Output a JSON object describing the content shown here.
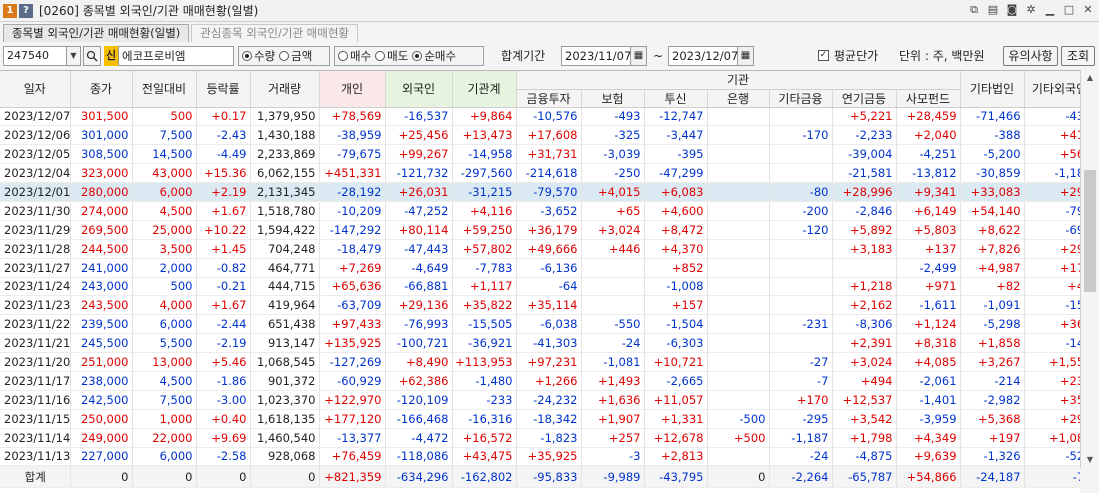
{
  "window": {
    "badge1": "1",
    "badge2": "?",
    "title": "[0260] 종목별 외국인/기관 매매현황(일별)"
  },
  "tabs": [
    {
      "label": "종목별 외국인/기관 매매현황(일별)"
    },
    {
      "label": "관심종목 외국인/기관 매매현황"
    }
  ],
  "toolbar": {
    "code": "247540",
    "badge": "신",
    "name": "에코프로비엠",
    "unit_radio": [
      {
        "label": "수량",
        "selected": true
      },
      {
        "label": "금액",
        "selected": false
      }
    ],
    "trade_radio": [
      {
        "label": "매수",
        "selected": false
      },
      {
        "label": "매도",
        "selected": false
      },
      {
        "label": "순매수",
        "selected": true
      }
    ],
    "period_label": "합계기간",
    "date_from": "2023/11/07",
    "tilde": "~",
    "date_to": "2023/12/07",
    "avg_label": "평균단가",
    "avg_checked": true,
    "unit_text": "단위 : 주, 백만원",
    "notice_button": "유의사항",
    "query_button": "조회"
  },
  "headers": {
    "date": "일자",
    "close": "종가",
    "change": "전일대비",
    "rate": "등락률",
    "volume": "거래량",
    "individual": "개인",
    "foreign": "외국인",
    "institution": "기관계",
    "inst_group": "기관",
    "financial": "금융투자",
    "insurance": "보험",
    "trust": "투신",
    "bank": "은행",
    "other_fin": "기타금융",
    "pension": "연기금등",
    "private_fund": "사모펀드",
    "other_corp": "기타법인",
    "other_foreign": "기타외국인"
  },
  "rows": [
    [
      "2023/12/07",
      "301,500",
      "500",
      "+0.17",
      "1,379,950",
      "+78,569",
      "-16,537",
      "+9,864",
      "-10,576",
      "-493",
      "-12,747",
      "",
      "",
      "+5,221",
      "+28,459",
      "-71,466",
      "-430"
    ],
    [
      "2023/12/06",
      "301,000",
      "7,500",
      "-2.43",
      "1,430,188",
      "-38,959",
      "+25,456",
      "+13,473",
      "+17,608",
      "-325",
      "-3,447",
      "",
      "-170",
      "-2,233",
      "+2,040",
      "-388",
      "+418"
    ],
    [
      "2023/12/05",
      "308,500",
      "14,500",
      "-4.49",
      "2,233,869",
      "-79,675",
      "+99,267",
      "-14,958",
      "+31,731",
      "-3,039",
      "-395",
      "",
      "",
      "-39,004",
      "-4,251",
      "-5,200",
      "+566"
    ],
    [
      "2023/12/04",
      "323,000",
      "43,000",
      "+15.36",
      "6,062,155",
      "+451,331",
      "-121,732",
      "-297,560",
      "-214,618",
      "-250",
      "-47,299",
      "",
      "",
      "-21,581",
      "-13,812",
      "-30,859",
      "-1,180"
    ],
    [
      "2023/12/01",
      "280,000",
      "6,000",
      "+2.19",
      "2,131,345",
      "-28,192",
      "+26,031",
      "-31,215",
      "-79,570",
      "+4,015",
      "+6,083",
      "",
      "-80",
      "+28,996",
      "+9,341",
      "+33,083",
      "+293"
    ],
    [
      "2023/11/30",
      "274,000",
      "4,500",
      "+1.67",
      "1,518,780",
      "-10,209",
      "-47,252",
      "+4,116",
      "-3,652",
      "+65",
      "+4,600",
      "",
      "-200",
      "-2,846",
      "+6,149",
      "+54,140",
      "-795"
    ],
    [
      "2023/11/29",
      "269,500",
      "25,000",
      "+10.22",
      "1,594,422",
      "-147,292",
      "+80,114",
      "+59,250",
      "+36,179",
      "+3,024",
      "+8,472",
      "",
      "-120",
      "+5,892",
      "+5,803",
      "+8,622",
      "-694"
    ],
    [
      "2023/11/28",
      "244,500",
      "3,500",
      "+1.45",
      "704,248",
      "-18,479",
      "-47,443",
      "+57,802",
      "+49,666",
      "+446",
      "+4,370",
      "",
      "",
      "+3,183",
      "+137",
      "+7,826",
      "+294"
    ],
    [
      "2023/11/27",
      "241,000",
      "2,000",
      "-0.82",
      "464,771",
      "+7,269",
      "-4,649",
      "-7,783",
      "-6,136",
      "",
      "+852",
      "",
      "",
      "",
      "-2,499",
      "+4,987",
      "+176"
    ],
    [
      "2023/11/24",
      "243,000",
      "500",
      "-0.21",
      "444,715",
      "+65,636",
      "-66,881",
      "+1,117",
      "-64",
      "",
      "-1,008",
      "",
      "",
      "+1,218",
      "+971",
      "+82",
      "+46"
    ],
    [
      "2023/11/23",
      "243,500",
      "4,000",
      "+1.67",
      "419,964",
      "-63,709",
      "+29,136",
      "+35,822",
      "+35,114",
      "",
      "+157",
      "",
      "",
      "+2,162",
      "-1,611",
      "-1,091",
      "-158"
    ],
    [
      "2023/11/22",
      "239,500",
      "6,000",
      "-2.44",
      "651,438",
      "+97,433",
      "-76,993",
      "-15,505",
      "-6,038",
      "-550",
      "-1,504",
      "",
      "-231",
      "-8,306",
      "+1,124",
      "-5,298",
      "+363"
    ],
    [
      "2023/11/21",
      "245,500",
      "5,500",
      "-2.19",
      "913,147",
      "+135,925",
      "-100,721",
      "-36,921",
      "-41,303",
      "-24",
      "-6,303",
      "",
      "",
      "+2,391",
      "+8,318",
      "+1,858",
      "-141"
    ],
    [
      "2023/11/20",
      "251,000",
      "13,000",
      "+5.46",
      "1,068,545",
      "-127,269",
      "+8,490",
      "+113,953",
      "+97,231",
      "-1,081",
      "+10,721",
      "",
      "-27",
      "+3,024",
      "+4,085",
      "+3,267",
      "+1,559"
    ],
    [
      "2023/11/17",
      "238,000",
      "4,500",
      "-1.86",
      "901,372",
      "-60,929",
      "+62,386",
      "-1,480",
      "+1,266",
      "+1,493",
      "-2,665",
      "",
      "-7",
      "+494",
      "-2,061",
      "-214",
      "+237"
    ],
    [
      "2023/11/16",
      "242,500",
      "7,500",
      "-3.00",
      "1,023,370",
      "+122,970",
      "-120,109",
      "-233",
      "-24,232",
      "+1,636",
      "+11,057",
      "",
      "+170",
      "+12,537",
      "-1,401",
      "-2,982",
      "+354"
    ],
    [
      "2023/11/15",
      "250,000",
      "1,000",
      "+0.40",
      "1,618,135",
      "+177,120",
      "-166,468",
      "-16,316",
      "-18,342",
      "+1,907",
      "+1,331",
      "-500",
      "-295",
      "+3,542",
      "-3,959",
      "+5,368",
      "+296"
    ],
    [
      "2023/11/14",
      "249,000",
      "22,000",
      "+9.69",
      "1,460,540",
      "-13,377",
      "-4,472",
      "+16,572",
      "-1,823",
      "+257",
      "+12,678",
      "+500",
      "-1,187",
      "+1,798",
      "+4,349",
      "+197",
      "+1,080"
    ],
    [
      "2023/11/13",
      "227,000",
      "6,000",
      "-2.58",
      "928,068",
      "+76,459",
      "-118,086",
      "+43,475",
      "+35,925",
      "-3",
      "+2,813",
      "",
      "-24",
      "-4,875",
      "+9,639",
      "-1,326",
      "-522"
    ]
  ],
  "selected_row": 4,
  "total": [
    "합계",
    "0",
    "0",
    "0",
    "0",
    "+821,359",
    "-634,296",
    "-162,802",
    "-95,833",
    "-9,989",
    "-43,795",
    "0",
    "-2,264",
    "-65,787",
    "+54,866",
    "-24,187",
    "-74"
  ]
}
